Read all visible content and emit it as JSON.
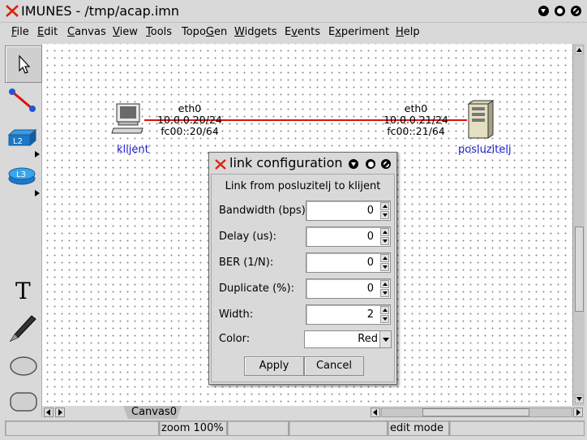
{
  "window": {
    "title": "IMUNES - /tmp/acap.imn"
  },
  "menu": [
    {
      "label": "File",
      "u": "F",
      "rest": "ile"
    },
    {
      "label": "Edit",
      "u": "E",
      "rest": "dit"
    },
    {
      "label": "Canvas",
      "u": "C",
      "rest": "anvas"
    },
    {
      "label": "View",
      "u": "V",
      "rest": "iew"
    },
    {
      "label": "Tools",
      "u": "T",
      "rest": "ools"
    },
    {
      "label": "TopoGen",
      "pre": "Topo",
      "u": "G",
      "rest": "en"
    },
    {
      "label": "Widgets",
      "u": "W",
      "rest": "idgets"
    },
    {
      "label": "Events",
      "pre": "E",
      "u": "v",
      "rest": "ents"
    },
    {
      "label": "Experiment",
      "pre": "E",
      "u": "x",
      "rest": "periment"
    },
    {
      "label": "Help",
      "u": "H",
      "rest": "elp"
    }
  ],
  "toolbar": {
    "icons": [
      "select-pointer-icon",
      "link-tool-icon",
      "l2-switch-icon",
      "l3-router-icon",
      "text-tool-icon",
      "pen-tool-icon",
      "oval-tool-icon",
      "rectangle-tool-icon"
    ],
    "l2_label": "L2",
    "l3_label": "L3",
    "text_glyph": "T"
  },
  "nodes": {
    "left": {
      "name": "klijent",
      "iface": "eth0",
      "ipv4": "10.0.0.20/24",
      "ipv6": "fc00::20/64"
    },
    "right": {
      "name": "posluzitelj",
      "iface": "eth0",
      "ipv4": "10.0.0.21/24",
      "ipv6": "fc00::21/64"
    },
    "link_color": "#dd1111"
  },
  "canvas_tab": "Canvas0",
  "status": {
    "zoom": "zoom 100%",
    "mode": "edit mode"
  },
  "dialog": {
    "title": "link configuration",
    "subtitle": "Link from posluzitelj to klijent",
    "fields": [
      {
        "label": "Bandwidth (bps):",
        "value": "0"
      },
      {
        "label": "Delay (us):",
        "value": "0"
      },
      {
        "label": "BER (1/N):",
        "value": "0"
      },
      {
        "label": "Duplicate (%):",
        "value": "0"
      },
      {
        "label": "Width:",
        "value": "2"
      }
    ],
    "color_label": "Color:",
    "color_value": "Red",
    "apply": "Apply",
    "cancel": "Cancel"
  }
}
